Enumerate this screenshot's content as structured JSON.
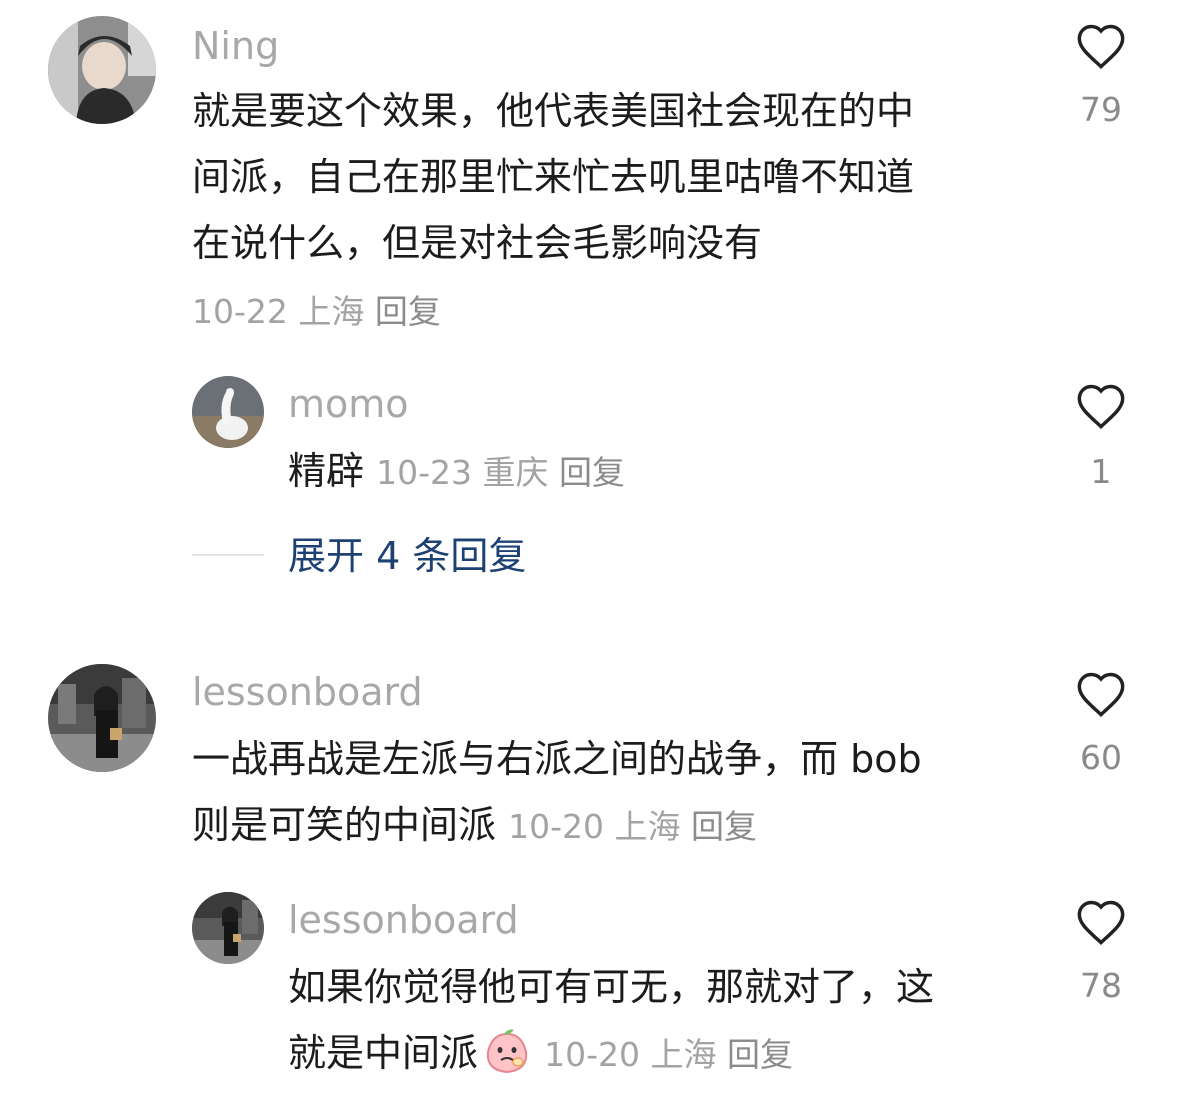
{
  "comments": [
    {
      "username": "Ning",
      "text_lines": [
        "就是要这个效果，他代表美国社会现在的中",
        "间派，自己在那里忙来忙去叽里咕噜不知道",
        "在说什么，但是对社会毛影响没有"
      ],
      "date": "10-22",
      "location": "上海",
      "reply_label": "回复",
      "likes": "79",
      "replies": [
        {
          "username": "momo",
          "text": "精辟",
          "date": "10-23",
          "location": "重庆",
          "reply_label": "回复",
          "likes": "1"
        }
      ],
      "expand_label": "展开 4 条回复"
    },
    {
      "username": "lessonboard",
      "text_lines": [
        "一战再战是左派与右派之间的战争，而 bob",
        "则是可笑的中间派"
      ],
      "date": "10-20",
      "location": "上海",
      "reply_label": "回复",
      "likes": "60",
      "replies": [
        {
          "username": "lessonboard",
          "text_lines": [
            "如果你觉得他可有可无，那就对了，这",
            "就是中间派"
          ],
          "emoji": "peach-emoji",
          "date": "10-20",
          "location": "上海",
          "reply_label": "回复",
          "likes": "78"
        }
      ]
    }
  ],
  "icons": {
    "like": "heart-outline-icon"
  },
  "colors": {
    "username": "#a8a8a8",
    "meta": "#a3a3a3",
    "expand": "#1e4174",
    "text": "#1c1c1c"
  }
}
